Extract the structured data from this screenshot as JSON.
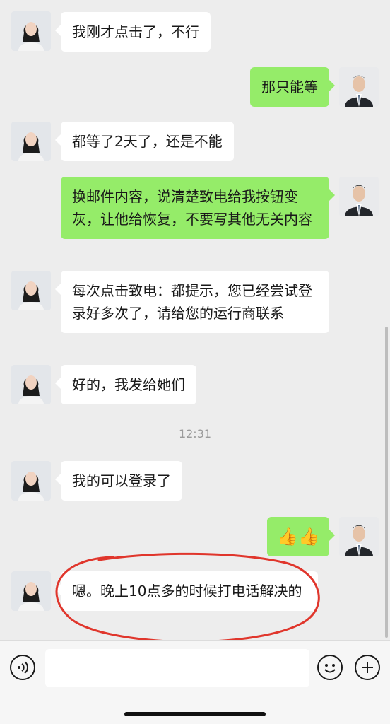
{
  "messages": [
    {
      "side": "in",
      "text": "我刚才点击了，不行"
    },
    {
      "side": "out",
      "text": "那只能等"
    },
    {
      "side": "in",
      "text": "都等了2天了，还是不能"
    },
    {
      "side": "out",
      "text": "换邮件内容，说清楚致电给我按钮变灰，让他给恢复，不要写其他无关内容"
    },
    {
      "side": "in",
      "text": "每次点击致电：都提示，您已经尝试登录好多次了，请给您的运行商联系"
    },
    {
      "side": "in",
      "text": "好的，我发给她们"
    },
    {
      "side": "in",
      "text": "我的可以登录了"
    },
    {
      "side": "out",
      "text": "👍👍"
    },
    {
      "side": "in",
      "text": "嗯。晚上10点多的时候打电话解决的"
    }
  ],
  "timestamp": "12:31",
  "input": {
    "value": ""
  },
  "icons": {
    "voice": "voice-icon",
    "emoji": "emoji-icon",
    "plus": "plus-icon"
  },
  "colors": {
    "background": "#ededed",
    "bubble_out": "#95ec69",
    "bubble_in": "#ffffff",
    "annotation": "#e0362c"
  }
}
